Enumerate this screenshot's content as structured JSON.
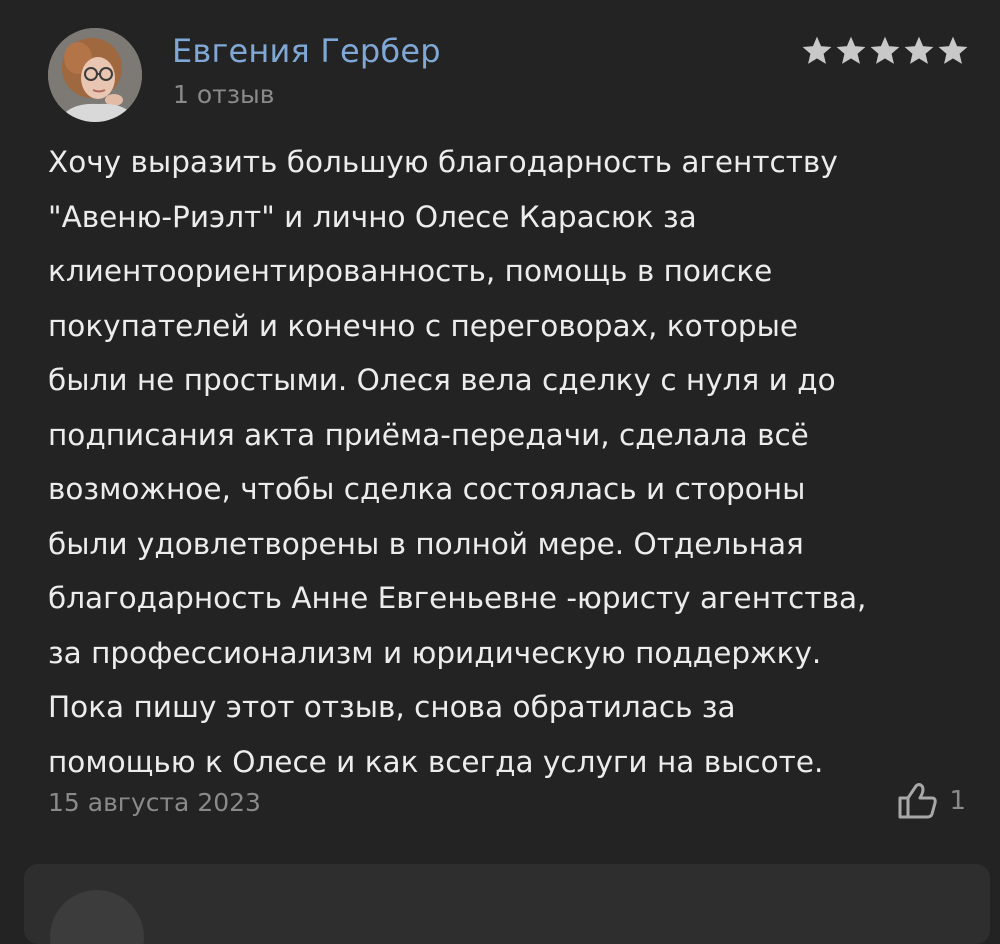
{
  "review": {
    "author": {
      "name": "Евгения Гербер",
      "review_count": "1 отзыв",
      "avatar": "user-avatar-photo"
    },
    "rating": 5,
    "rating_max": 5,
    "text": "Хочу выразить большую благодарность агентству\n\"Авеню-Риэлт\" и лично Олесе Карасюк за\nклиентоориентированность, помощь в поиске\nпокупателей и конечно с переговорах, которые\nбыли не простыми. Олеся вела сделку с нуля и до\nподписания акта приёма-передачи, сделала всё\nвозможное, чтобы сделка состоялась и стороны\nбыли удовлетворены в полной мере. Отдельная\nблагодарность Анне Евгеньевне -юристу агентства,\nза профессионализм и юридическую поддержку.\nПока пишу этот отзыв, снова обратилась за\nпомощью к Олесе и как всегда услуги на высоте.",
    "date": "15 августа 2023",
    "likes": "1",
    "like_icon": "thumbs-up-icon"
  },
  "colors": {
    "background": "#232323",
    "author_name": "#7fa8d6",
    "text": "#ececec",
    "muted": "#8a8a8a",
    "star": "#c8c8c8"
  }
}
